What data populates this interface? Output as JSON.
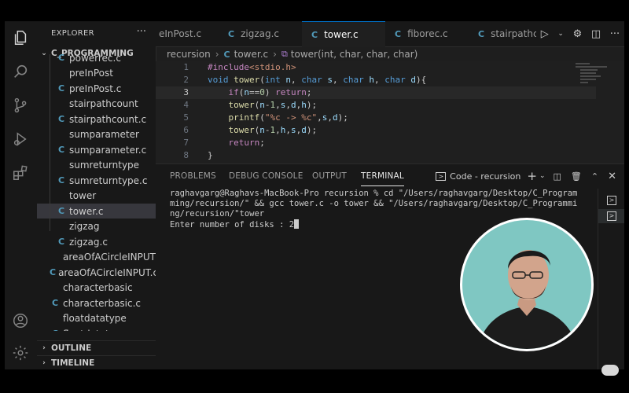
{
  "sidebar": {
    "title": "EXPLORER",
    "more": "···",
    "folder": "C_PROGRAMMING",
    "files": [
      {
        "name": "powerrec.c",
        "type": "c"
      },
      {
        "name": "preInPost",
        "type": "bin"
      },
      {
        "name": "preInPost.c",
        "type": "c"
      },
      {
        "name": "stairpathcount",
        "type": "bin"
      },
      {
        "name": "stairpathcount.c",
        "type": "c"
      },
      {
        "name": "sumparameter",
        "type": "bin"
      },
      {
        "name": "sumparameter.c",
        "type": "c"
      },
      {
        "name": "sumreturntype",
        "type": "bin"
      },
      {
        "name": "sumreturntype.c",
        "type": "c"
      },
      {
        "name": "tower",
        "type": "bin"
      },
      {
        "name": "tower.c",
        "type": "c"
      },
      {
        "name": "zigzag",
        "type": "bin"
      },
      {
        "name": "zigzag.c",
        "type": "c"
      },
      {
        "name": "areaOfACircleINPUT",
        "type": "bin"
      },
      {
        "name": "areaOfACircleINPUT.c",
        "type": "c"
      },
      {
        "name": "characterbasic",
        "type": "bin"
      },
      {
        "name": "characterbasic.c",
        "type": "c"
      },
      {
        "name": "floatdatatype",
        "type": "bin"
      },
      {
        "name": "floatdatatype.c",
        "type": "c"
      }
    ],
    "outline": "OUTLINE",
    "timeline": "TIMELINE"
  },
  "tabs": [
    {
      "label": "eInPost.c",
      "icon": "C"
    },
    {
      "label": "zigzag.c",
      "icon": "C"
    },
    {
      "label": "tower.c",
      "icon": "C"
    },
    {
      "label": "fiborec.c",
      "icon": "C"
    },
    {
      "label": "stairpathco",
      "icon": "C"
    }
  ],
  "breadcrumb": {
    "folder": "recursion",
    "file": "tower.c",
    "symbol": "tower(int, char, char, char)"
  },
  "editor": {
    "line_numbers": [
      "1",
      "2",
      "3",
      "4",
      "5",
      "6",
      "7",
      "8"
    ],
    "current_line": "3"
  },
  "panel": {
    "tabs": [
      "PROBLEMS",
      "DEBUG CONSOLE",
      "OUTPUT",
      "TERMINAL"
    ],
    "active_tab": "TERMINAL",
    "terminal_name": "Code - recursion",
    "terminal_text": "raghavgarg@Raghavs-MacBook-Pro recursion % cd \"/Users/raghavgarg/Desktop/C_Programming/recursion/\" && gcc tower.c -o tower && \"/Users/raghavgarg/Desktop/C_Programming/recursion/\"tower\nEnter number of disks : 2"
  },
  "colors": {
    "accent": "#0078d4",
    "c_icon": "#519aba",
    "keyword": "#569cd6",
    "control": "#c586c0",
    "function": "#dcdcaa",
    "string": "#ce9178",
    "number": "#b5cea8"
  }
}
